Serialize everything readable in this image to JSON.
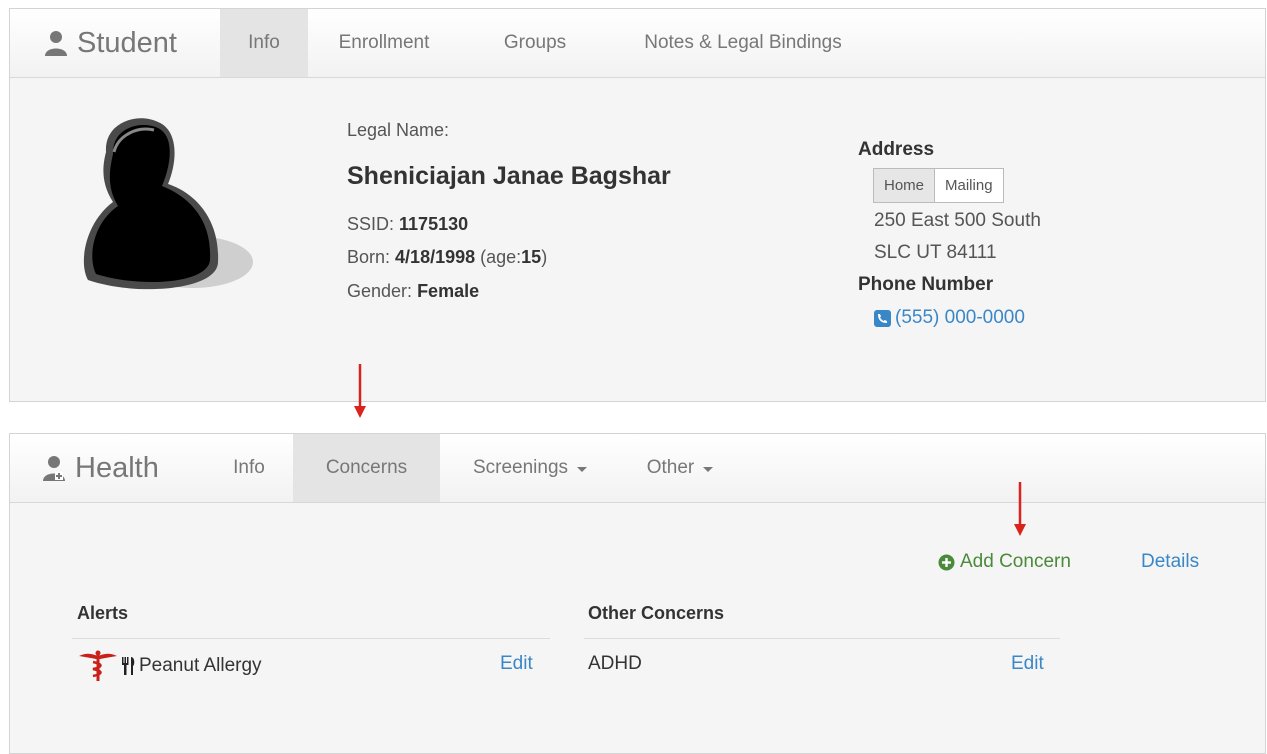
{
  "student": {
    "brand": "Student",
    "tabs": [
      "Info",
      "Enrollment",
      "Groups",
      "Notes & Legal Bindings"
    ],
    "legal_name_label": "Legal Name:",
    "name": "Sheniciajan Janae Bagshar",
    "ssid_label": "SSID:",
    "ssid": "1175130",
    "born_label": "Born:",
    "born": "4/18/1998",
    "age_open": "(age:",
    "age": "15",
    "age_close": ")",
    "gender_label": "Gender:",
    "gender": "Female",
    "address_title": "Address",
    "address_tabs": [
      "Home",
      "Mailing"
    ],
    "address_line1": "250 East 500 South",
    "address_line2": "SLC UT 84111",
    "phone_title": "Phone Number",
    "phone": "(555) 000-0000"
  },
  "health": {
    "brand": "Health",
    "tabs": [
      "Info",
      "Concerns",
      "Screenings",
      "Other"
    ],
    "add_concern": "Add Concern",
    "details": "Details",
    "alerts_title": "Alerts",
    "alert_item": "Peanut Allergy",
    "alert_edit": "Edit",
    "other_title": "Other Concerns",
    "other_item": "ADHD",
    "other_edit": "Edit"
  },
  "colors": {
    "link": "#3a87c8",
    "add": "#4a8a3a",
    "annotation": "#d9231c"
  }
}
